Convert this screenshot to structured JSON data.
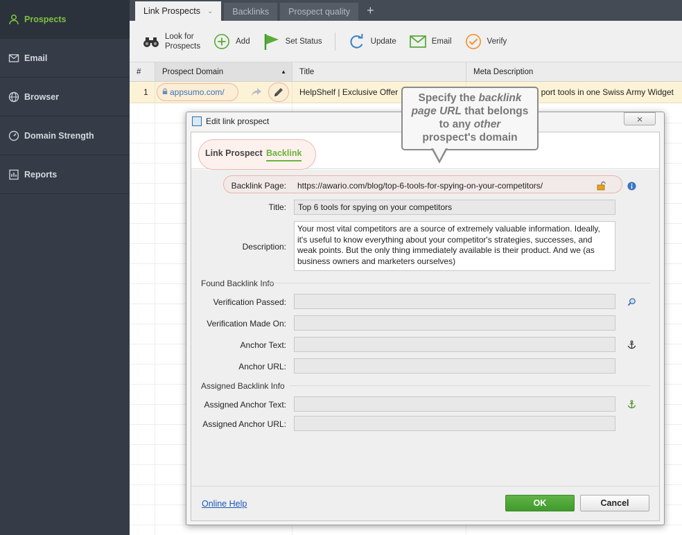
{
  "sidebar": {
    "items": [
      {
        "label": "Prospects",
        "icon": "user-icon",
        "active": true
      },
      {
        "label": "Email",
        "icon": "envelope-icon"
      },
      {
        "label": "Browser",
        "icon": "globe-icon"
      },
      {
        "label": "Domain Strength",
        "icon": "gauge-icon"
      },
      {
        "label": "Reports",
        "icon": "report-icon"
      }
    ]
  },
  "tabs": [
    {
      "label": "Link Prospects",
      "active": true
    },
    {
      "label": "Backlinks"
    },
    {
      "label": "Prospect quality"
    }
  ],
  "toolbar": {
    "look_for_line1": "Look for",
    "look_for_line2": "Prospects",
    "add": "Add",
    "set_status": "Set Status",
    "update": "Update",
    "email": "Email",
    "verify": "Verify"
  },
  "grid": {
    "columns": [
      "#",
      "Prospect Domain",
      "Title",
      "Meta Description"
    ],
    "rows": [
      {
        "num": "1",
        "domain": "appsumo.com/",
        "title": "HelpShelf | Exclusive Offer",
        "meta": "port tools in one Swiss Army Widget"
      }
    ]
  },
  "callout": {
    "line1_a": "Specify the ",
    "line1_b": "backlink",
    "line2_a": "page URL",
    "line2_b": " that belongs",
    "line3_a": "to any ",
    "line3_b": "other",
    "line4": "prospect's domain"
  },
  "dialog": {
    "title": "Edit link prospect",
    "close_glyph": "⨯",
    "tab_prospect": "Link Prospect",
    "tab_backlink": "Backlink",
    "backlink_page_label": "Backlink Page:",
    "backlink_page_value": "https://awario.com/blog/top-6-tools-for-spying-on-your-competitors/",
    "title_label": "Title:",
    "title_value": "Top 6 tools for spying on your competitors",
    "description_label": "Description:",
    "description_value": "Your most vital competitors are a source of extremely valuable information. Ideally, it's useful to know everything about your competitor's strategies, successes, and weak points. But the only thing immediately available is their product. And we (as business owners and marketers ourselves)",
    "found_section": "Found Backlink Info",
    "verification_passed_label": "Verification Passed:",
    "verification_made_on_label": "Verification Made On:",
    "anchor_text_label": "Anchor Text:",
    "anchor_url_label": "Anchor URL:",
    "assigned_section": "Assigned Backlink Info",
    "assigned_anchor_text_label": "Assigned Anchor Text:",
    "assigned_anchor_url_label": "Assigned Anchor URL:",
    "online_help": "Online Help",
    "ok": "OK",
    "cancel": "Cancel"
  },
  "colors": {
    "accent_green": "#6bb33b",
    "sidebar_bg": "#353c47",
    "highlight_row": "#fcf3d6"
  }
}
